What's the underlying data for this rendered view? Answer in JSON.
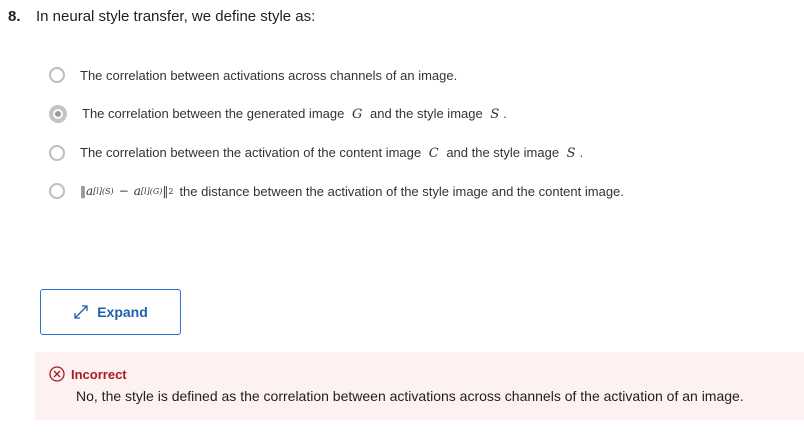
{
  "question": {
    "number": "8.",
    "text": "In neural style transfer, we define style as:"
  },
  "options": [
    {
      "text": "The correlation between activations across channels of an image.",
      "selected": false
    },
    {
      "text_before": "The correlation between the generated image",
      "var1": "G",
      "text_mid": "and the style image",
      "var2": "S",
      "text_after": ".",
      "selected": true
    },
    {
      "text_before": "The correlation between the activation of the content image",
      "var1": "C",
      "text_mid": "and the style image",
      "var2": "S",
      "text_after": ".",
      "selected": false
    },
    {
      "formula": {
        "a1": "a",
        "sup1": "[l](S)",
        "minus": "−",
        "a2": "a",
        "sup2": "[l](G)",
        "sq": "2"
      },
      "text": "the distance between the activation of the style image and the content image.",
      "selected": false
    }
  ],
  "expand": {
    "label": "Expand",
    "icon": "expand-arrows-icon"
  },
  "feedback": {
    "status": "Incorrect",
    "icon": "x-circle-icon",
    "message": "No, the style is defined as the correlation between activations across channels of the activation of an image.",
    "color": "#a81d1d",
    "background": "#fdf1f1"
  }
}
